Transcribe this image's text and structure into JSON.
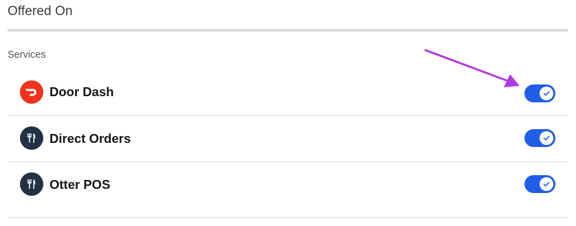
{
  "header": {
    "title": "Offered On"
  },
  "services": {
    "label": "Services",
    "items": [
      {
        "name": "Door Dash",
        "icon": "doordash-logo-icon",
        "enabled": true
      },
      {
        "name": "Direct Orders",
        "icon": "fork-knife-icon",
        "enabled": true
      },
      {
        "name": "Otter POS",
        "icon": "fork-knife-icon",
        "enabled": true
      }
    ]
  },
  "annotation": {
    "arrow_color": "#b23ae6"
  },
  "colors": {
    "toggle_on": "#1f5ee6",
    "doordash_red": "#f0321e",
    "fork_icon_bg": "#243143"
  }
}
